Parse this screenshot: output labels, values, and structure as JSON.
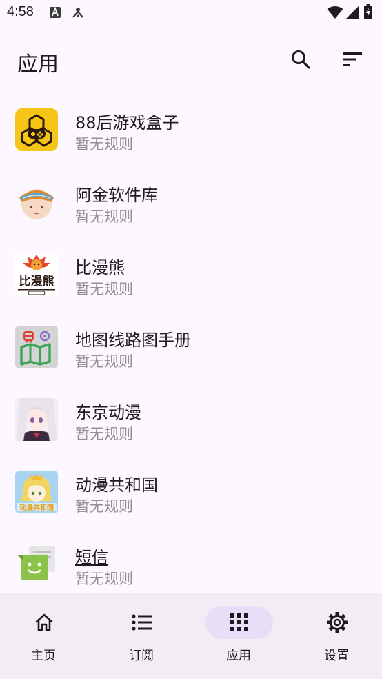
{
  "status_bar": {
    "time": "4:58",
    "icons": [
      "a-notification-icon",
      "debug-notification-icon",
      "wifi-icon",
      "signal-icon",
      "battery-icon"
    ]
  },
  "header": {
    "title": "应用",
    "actions": [
      "search-icon",
      "sort-icon"
    ]
  },
  "apps": [
    {
      "name": "88后游戏盒子",
      "rule": "暂无规则",
      "icon": "game-box-app-icon"
    },
    {
      "name": "阿金软件库",
      "rule": "暂无规则",
      "icon": "ajin-app-icon"
    },
    {
      "name": "比漫熊",
      "rule": "暂无规则",
      "icon": "bimanxiong-app-icon",
      "icon_text": "比漫熊"
    },
    {
      "name": "地图线路图手册",
      "rule": "暂无规则",
      "icon": "map-app-icon"
    },
    {
      "name": "东京动漫",
      "rule": "暂无规则",
      "icon": "tokyo-anime-app-icon"
    },
    {
      "name": "动漫共和国",
      "rule": "暂无规则",
      "icon": "anime-republic-app-icon",
      "icon_text": "动漫共和国"
    },
    {
      "name": "短信",
      "rule": "暂无规则",
      "icon": "messages-app-icon"
    }
  ],
  "nav": {
    "items": [
      {
        "label": "主页",
        "icon": "home-icon",
        "active": false
      },
      {
        "label": "订阅",
        "icon": "list-icon",
        "active": false
      },
      {
        "label": "应用",
        "icon": "apps-grid-icon",
        "active": true
      },
      {
        "label": "设置",
        "icon": "gear-icon",
        "active": false
      }
    ]
  },
  "colors": {
    "background": "#fdf7ff",
    "nav_background": "#f2ecf4",
    "active_pill": "#e8def8",
    "secondary_text": "#938f99"
  }
}
